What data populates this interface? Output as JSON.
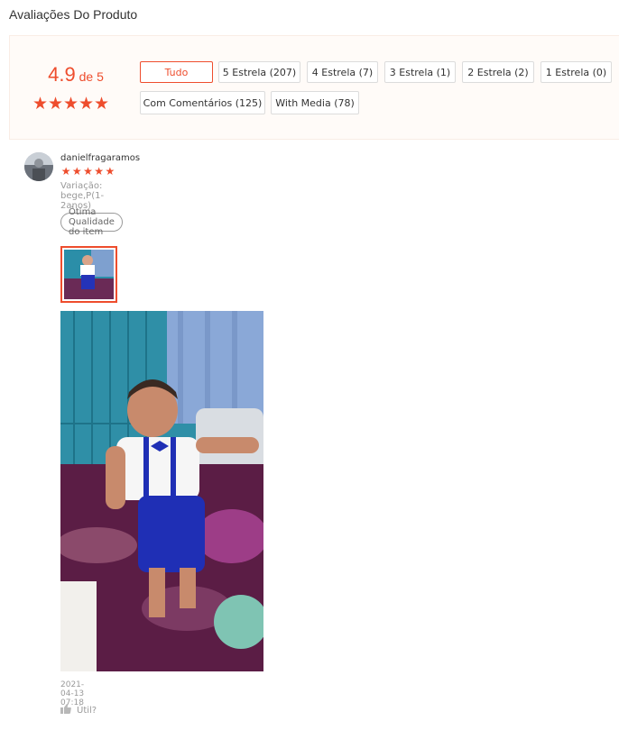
{
  "page": {
    "title": "Avaliações Do Produto"
  },
  "overview": {
    "score": "4.9",
    "score_suffix": " de 5",
    "rating_stars": 5,
    "filters": [
      "Tudo",
      "5 Estrela (207)",
      "4 Estrela (7)",
      "3 Estrela (1)",
      "2 Estrela (2)",
      "1 Estrela (0)",
      "Com Comentários (125)",
      "With Media (78)"
    ],
    "active_filter": "Tudo"
  },
  "review": {
    "username": "danielfragaramos",
    "rating": 5,
    "variation": "Variação: bege,P(1-2anos)",
    "tag": "Ótima Qualidade do item",
    "timestamp": "2021-04-13 07:18",
    "like_label": "Útil?"
  },
  "icons": {
    "star": "star-icon",
    "like": "thumbs-up-icon"
  },
  "colors": {
    "accent": "#ee4d2d",
    "overview_bg": "#fffbf8",
    "muted_text": "#999999"
  }
}
